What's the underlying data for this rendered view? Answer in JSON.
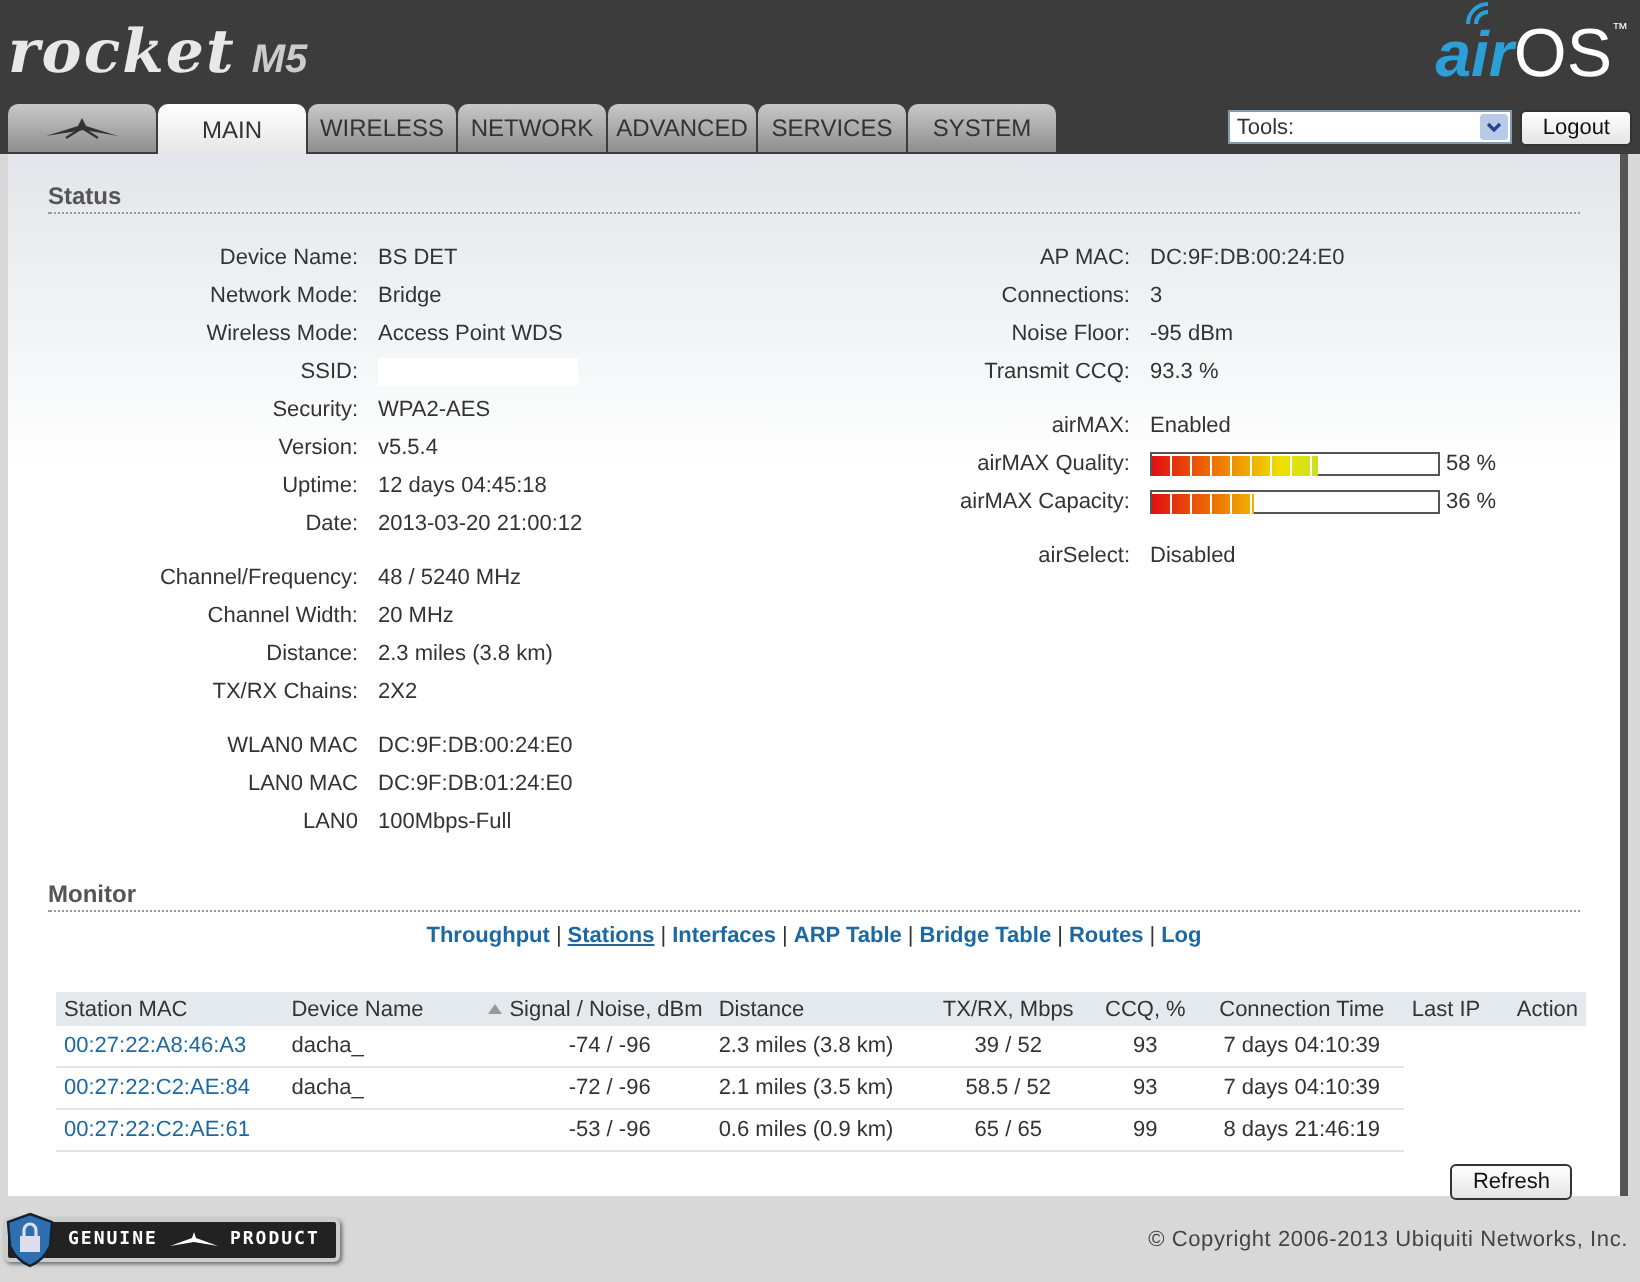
{
  "header": {
    "logo": {
      "name": "rocket",
      "model": "M5"
    },
    "os_logo": {
      "air": "air",
      "os": "OS",
      "tm": "™"
    }
  },
  "tabs": [
    {
      "kind": "icon",
      "selected": false
    },
    {
      "kind": "text",
      "label": "MAIN",
      "selected": true
    },
    {
      "kind": "text",
      "label": "WIRELESS",
      "selected": false
    },
    {
      "kind": "text",
      "label": "NETWORK",
      "selected": false
    },
    {
      "kind": "text",
      "label": "ADVANCED",
      "selected": false
    },
    {
      "kind": "text",
      "label": "SERVICES",
      "selected": false
    },
    {
      "kind": "text",
      "label": "SYSTEM",
      "selected": false
    }
  ],
  "tools": {
    "value": "Tools:"
  },
  "logout_button": "Logout",
  "status": {
    "title": "Status",
    "left": [
      [
        {
          "kind": "text",
          "label": "Device Name:",
          "value": "BS DET"
        },
        {
          "kind": "text",
          "label": "Network Mode:",
          "value": "Bridge"
        },
        {
          "kind": "text",
          "label": "Wireless Mode:",
          "value": "Access Point WDS"
        },
        {
          "kind": "blank",
          "label": "SSID:"
        },
        {
          "kind": "text",
          "label": "Security:",
          "value": "WPA2-AES"
        },
        {
          "kind": "text",
          "label": "Version:",
          "value": "v5.5.4"
        },
        {
          "kind": "text",
          "label": "Uptime:",
          "value": "12 days 04:45:18"
        },
        {
          "kind": "text",
          "label": "Date:",
          "value": "2013-03-20 21:00:12"
        }
      ],
      [
        {
          "kind": "text",
          "label": "Channel/Frequency:",
          "value": "48 / 5240 MHz"
        },
        {
          "kind": "text",
          "label": "Channel Width:",
          "value": "20 MHz"
        },
        {
          "kind": "text",
          "label": "Distance:",
          "value": "2.3 miles (3.8 km)"
        },
        {
          "kind": "text",
          "label": "TX/RX Chains:",
          "value": "2X2"
        }
      ],
      [
        {
          "kind": "text",
          "label": "WLAN0 MAC",
          "value": "DC:9F:DB:00:24:E0"
        },
        {
          "kind": "text",
          "label": "LAN0 MAC",
          "value": "DC:9F:DB:01:24:E0"
        },
        {
          "kind": "text",
          "label": "LAN0",
          "value": "100Mbps-Full"
        }
      ]
    ],
    "right": [
      [
        {
          "kind": "text",
          "label": "AP MAC:",
          "value": "DC:9F:DB:00:24:E0"
        },
        {
          "kind": "text",
          "label": "Connections:",
          "value": "3"
        },
        {
          "kind": "text",
          "label": "Noise Floor:",
          "value": "-95 dBm"
        },
        {
          "kind": "text",
          "label": "Transmit CCQ:",
          "value": "93.3 %"
        }
      ],
      [
        {
          "kind": "text",
          "label": "airMAX:",
          "value": "Enabled"
        },
        {
          "kind": "meter",
          "label": "airMAX Quality:",
          "level": 0.58,
          "value": "58 %"
        },
        {
          "kind": "meter",
          "label": "airMAX Capacity:",
          "level": 0.36,
          "value": "36 %"
        }
      ],
      [
        {
          "kind": "text",
          "label": "airSelect:",
          "value": "Disabled"
        }
      ]
    ]
  },
  "monitor": {
    "title": "Monitor",
    "separator": "|",
    "links": [
      {
        "label": "Throughput",
        "selected": false
      },
      {
        "label": "Stations",
        "selected": true
      },
      {
        "label": "Interfaces",
        "selected": false
      },
      {
        "label": "ARP Table",
        "selected": false
      },
      {
        "label": "Bridge Table",
        "selected": false
      },
      {
        "label": "Routes",
        "selected": false
      },
      {
        "label": "Log",
        "selected": false
      }
    ],
    "table": {
      "columns": [
        {
          "label": "Station MAC",
          "sorted": false
        },
        {
          "label": "Device Name",
          "sorted": false
        },
        {
          "label": "Signal / Noise, dBm",
          "sorted": true
        },
        {
          "label": "Distance",
          "sorted": false
        },
        {
          "label": "TX/RX, Mbps",
          "sorted": false
        },
        {
          "label": "CCQ, %",
          "sorted": false
        },
        {
          "label": "Connection Time",
          "sorted": false
        },
        {
          "label": "Last IP",
          "sorted": false
        },
        {
          "label": "Action",
          "sorted": false
        }
      ],
      "rows": [
        [
          "00:27:22:A8:46:A3",
          "dacha_",
          "-74 / -96",
          "2.3 miles (3.8 km)",
          "39 / 52",
          "93",
          "7 days 04:10:39"
        ],
        [
          "00:27:22:C2:AE:84",
          "dacha_",
          "-72 / -96",
          "2.1 miles (3.5 km)",
          "58.5 / 52",
          "93",
          "7 days 04:10:39"
        ],
        [
          "00:27:22:C2:AE:61",
          "",
          "-53 / -96",
          "0.6 miles (0.9 km)",
          "65 / 65",
          "99",
          "8 days 21:46:19"
        ]
      ]
    },
    "refresh_button": "Refresh"
  },
  "footer": {
    "badge": {
      "left": "GENUINE",
      "right": "PRODUCT"
    },
    "copyright": "© Copyright 2006-2013 Ubiquiti Networks, Inc."
  }
}
